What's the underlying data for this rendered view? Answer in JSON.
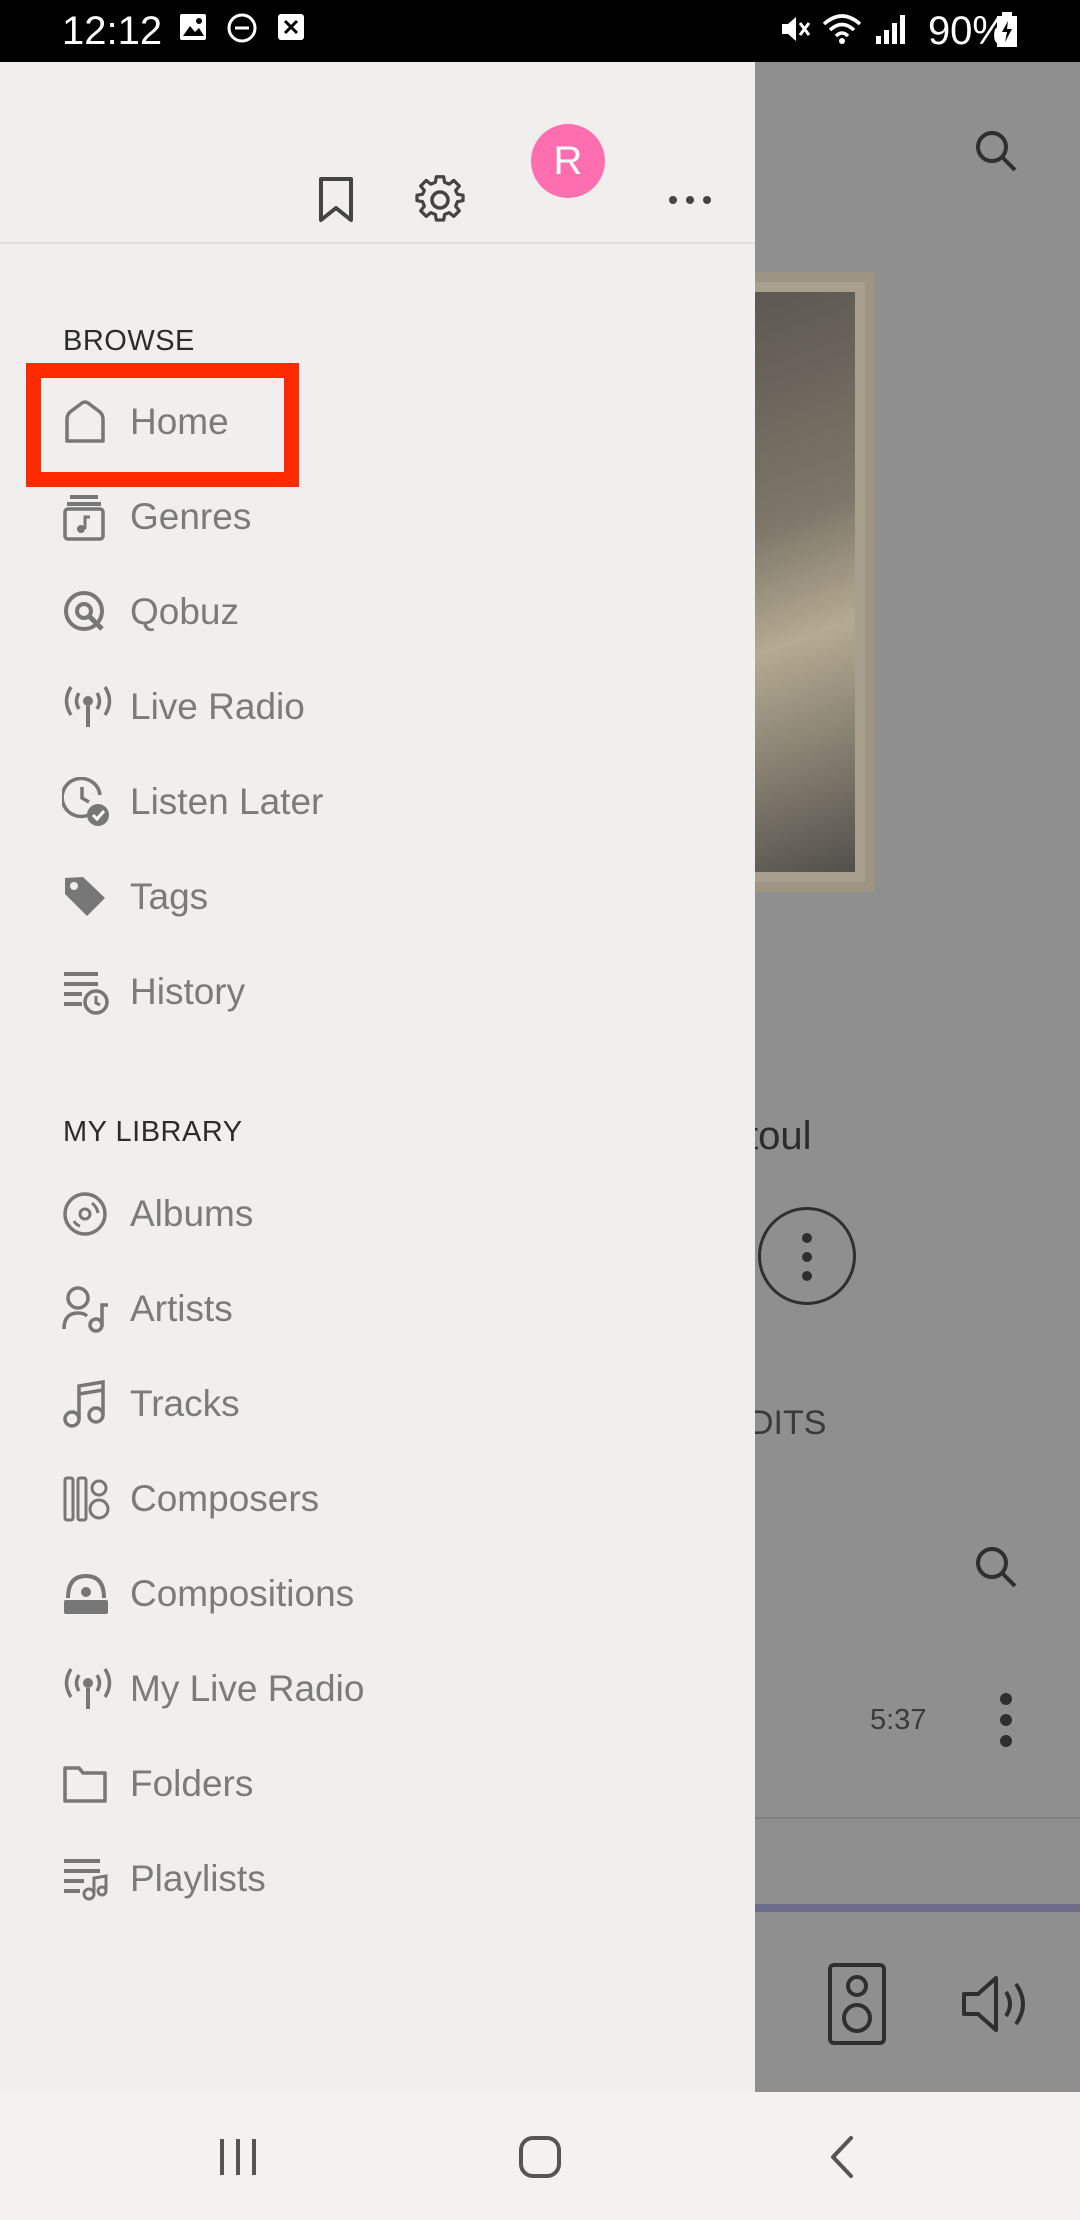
{
  "status_bar": {
    "time": "12:12",
    "battery": "90%"
  },
  "drawer": {
    "avatar_letter": "R",
    "browse": {
      "title": "BROWSE",
      "items": [
        "Home",
        "Genres",
        "Qobuz",
        "Live Radio",
        "Listen Later",
        "Tags",
        "History"
      ]
    },
    "library": {
      "title": "MY LIBRARY",
      "items": [
        "Albums",
        "Artists",
        "Tracks",
        "Composers",
        "Compositions",
        "My Live Radio",
        "Folders",
        "Playlists"
      ]
    }
  },
  "background": {
    "artist_fragment": "toul",
    "credits_fragment": "DITS",
    "duration": "5:37"
  },
  "colors": {
    "accent_avatar": "#ff6fb0",
    "highlight_box": "#ff2a00"
  }
}
